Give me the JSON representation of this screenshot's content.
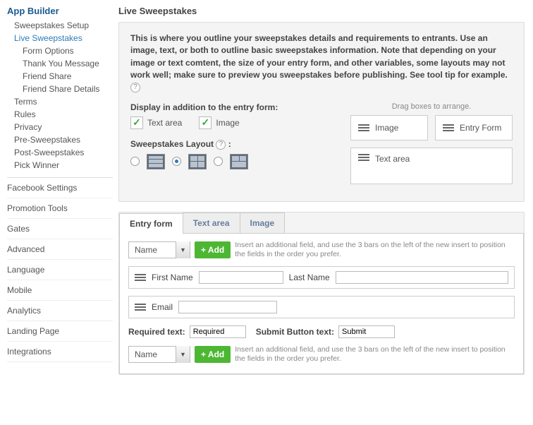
{
  "sidebar": {
    "title": "App Builder",
    "tree": [
      {
        "label": "Sweepstakes Setup",
        "cls": "sub1"
      },
      {
        "label": "Live Sweepstakes",
        "cls": "sub1 active"
      },
      {
        "label": "Form Options",
        "cls": "sub2"
      },
      {
        "label": "Thank You Message",
        "cls": "sub2"
      },
      {
        "label": "Friend Share",
        "cls": "sub2"
      },
      {
        "label": "Friend Share Details",
        "cls": "sub2"
      },
      {
        "label": "Terms",
        "cls": "sub1"
      },
      {
        "label": "Rules",
        "cls": "sub1"
      },
      {
        "label": "Privacy",
        "cls": "sub1"
      },
      {
        "label": "Pre-Sweepstakes",
        "cls": "sub1"
      },
      {
        "label": "Post-Sweepstakes",
        "cls": "sub1"
      },
      {
        "label": "Pick Winner",
        "cls": "sub1"
      }
    ],
    "main_nav": [
      "Facebook Settings",
      "Promotion Tools",
      "Gates",
      "Advanced",
      "Language",
      "Mobile",
      "Analytics",
      "Landing Page",
      "Integrations"
    ]
  },
  "content": {
    "title": "Live Sweepstakes",
    "description": "This is where you outline your sweepstakes details and requirements to entrants. Use an image, text, or both to outline basic sweepstakes information. Note that depending on your image or text comtent, the size of your entry form, and other variables, some layouts may not work well; make sure to preview you sweepstakes before publishing. See tool tip for example.",
    "display_label": "Display in addition to the entry form:",
    "check_text": "Text area",
    "check_image": "Image",
    "layout_label": "Sweepstakes Layout",
    "drag_hint": "Drag boxes to arrange.",
    "boxes": {
      "image": "Image",
      "entry": "Entry Form",
      "textarea": "Text area"
    }
  },
  "tabs": {
    "entry": "Entry form",
    "text": "Text area",
    "image": "Image"
  },
  "form": {
    "select_value": "Name",
    "add_label": "+ Add",
    "add_hint": "Insert an additional field, and use the 3 bars on the left of the new insert to position the fields in the order you prefer.",
    "first_name": "First Name",
    "last_name": "Last Name",
    "email": "Email",
    "required_label": "Required text:",
    "required_value": "Required",
    "submit_label": "Submit Button text:",
    "submit_value": "Submit"
  }
}
